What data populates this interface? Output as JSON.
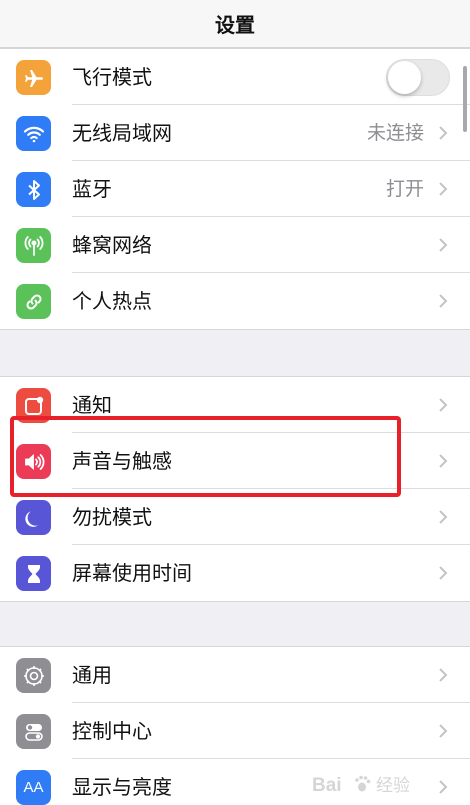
{
  "header": {
    "title": "设置"
  },
  "groups": [
    {
      "items": [
        {
          "label": "飞行模式",
          "icon": "airplane-icon",
          "icon_color": "#f3a33a",
          "toggle": false
        },
        {
          "label": "无线局域网",
          "icon": "wifi-icon",
          "icon_color": "#2f7cf6",
          "value": "未连接"
        },
        {
          "label": "蓝牙",
          "icon": "bluetooth-icon",
          "icon_color": "#2f7cf6",
          "value": "打开"
        },
        {
          "label": "蜂窝网络",
          "icon": "cellular-icon",
          "icon_color": "#5bc25a"
        },
        {
          "label": "个人热点",
          "icon": "hotspot-icon",
          "icon_color": "#5bc25a"
        }
      ]
    },
    {
      "items": [
        {
          "label": "通知",
          "icon": "notifications-icon",
          "icon_color": "#ec4d40"
        },
        {
          "label": "声音与触感",
          "icon": "speaker-icon",
          "icon_color": "#ec3b57",
          "highlighted": true
        },
        {
          "label": "勿扰模式",
          "icon": "moon-icon",
          "icon_color": "#5856d6"
        },
        {
          "label": "屏幕使用时间",
          "icon": "hourglass-icon",
          "icon_color": "#5856d6"
        }
      ]
    },
    {
      "items": [
        {
          "label": "通用",
          "icon": "gear-icon",
          "icon_color": "#8e8e93"
        },
        {
          "label": "控制中心",
          "icon": "switches-icon",
          "icon_color": "#8e8e93"
        },
        {
          "label": "显示与亮度",
          "icon": "text-size-icon",
          "icon_color": "#2f7cf6",
          "icon_text": "AA"
        }
      ]
    }
  ],
  "watermark": {
    "brand": "Bai",
    "suffix": "经验",
    "icon": "baidu-paw-icon"
  }
}
